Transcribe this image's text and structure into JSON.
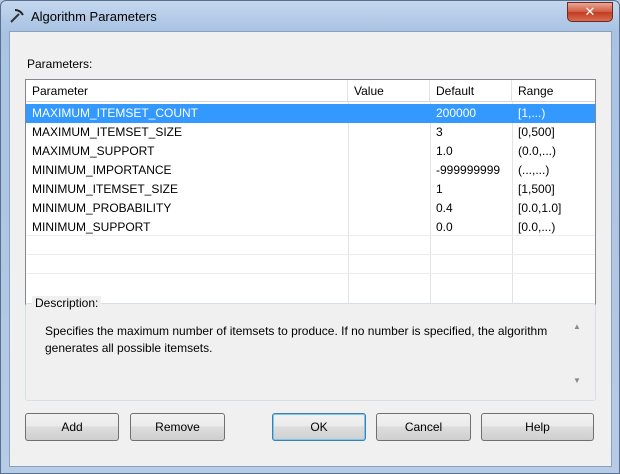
{
  "window": {
    "title": "Algorithm Parameters",
    "close_glyph": "✕"
  },
  "parameters_label": "Parameters:",
  "grid": {
    "columns": [
      "Parameter",
      "Value",
      "Default",
      "Range"
    ],
    "rows": [
      {
        "parameter": "MAXIMUM_ITEMSET_COUNT",
        "value": "",
        "default": "200000",
        "range": "[1,...)",
        "selected": true
      },
      {
        "parameter": "MAXIMUM_ITEMSET_SIZE",
        "value": "",
        "default": "3",
        "range": "[0,500]"
      },
      {
        "parameter": "MAXIMUM_SUPPORT",
        "value": "",
        "default": "1.0",
        "range": "(0.0,...)"
      },
      {
        "parameter": "MINIMUM_IMPORTANCE",
        "value": "",
        "default": "-999999999",
        "range": "(...,...)"
      },
      {
        "parameter": "MINIMUM_ITEMSET_SIZE",
        "value": "",
        "default": "1",
        "range": "[1,500]"
      },
      {
        "parameter": "MINIMUM_PROBABILITY",
        "value": "",
        "default": "0.4",
        "range": "[0.0,1.0]"
      },
      {
        "parameter": "MINIMUM_SUPPORT",
        "value": "",
        "default": "0.0",
        "range": "[0.0,...)"
      }
    ]
  },
  "description": {
    "label": "Description:",
    "text": "Specifies the maximum number of itemsets to produce. If no number is specified, the algorithm generates all possible itemsets."
  },
  "buttons": {
    "add": "Add",
    "remove": "Remove",
    "ok": "OK",
    "cancel": "Cancel",
    "help": "Help"
  }
}
